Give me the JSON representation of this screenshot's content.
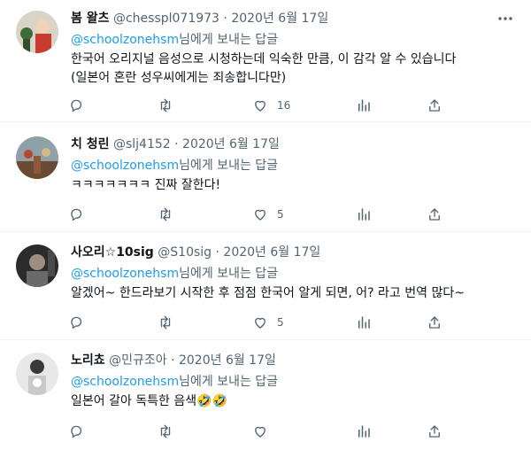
{
  "tweets": [
    {
      "display_name": "봄 왈츠",
      "handle": "@chesspl071973",
      "date": "2020년 6월 17일",
      "mention": "@schoolzonehsm",
      "reply_suffix": "님에게 보내는 답글",
      "text_lines": [
        "한국어 오리지널 음성으로 시청하는데 익숙한 만큼, 이 감각 알 수 있습니다",
        "(일본어 혼란 성우씨에게는 죄송합니다만)"
      ],
      "like_count": "16",
      "avatar_colors": [
        "#d9d4c7",
        "#c93a2f",
        "#3d6b3a"
      ]
    },
    {
      "display_name": "치 청린",
      "handle": "@slj4152",
      "date": "2020년 6월 17일",
      "mention": "@schoolzonehsm",
      "reply_suffix": "님에게 보내는 답글",
      "text_lines": [
        "ㅋㅋㅋㅋㅋㅋㅋ 진짜 잘한다!"
      ],
      "like_count": "5",
      "avatar_colors": [
        "#8fa0a8",
        "#8a5a3a",
        "#b6472e"
      ]
    },
    {
      "display_name": "사오리☆10sig",
      "handle": "@S10sig",
      "date": "2020년 6월 17일",
      "mention": "@schoolzonehsm",
      "reply_suffix": "님에게 보내는 답글",
      "text_lines": [
        "알겠어~ 한드라보기 시작한 후 점점 한국어 알게 되면, 어? 라고 번역 많다~"
      ],
      "like_count": "5",
      "avatar_colors": [
        "#2b2b2b",
        "#6a6a6a",
        "#9c8f80"
      ]
    },
    {
      "display_name": "노리쵸",
      "handle": "@민규조아",
      "date": "2020년 6월 17일",
      "mention": "@schoolzonehsm",
      "reply_suffix": "님에게 보내는 답글",
      "text_lines": [
        "일본어 갈아 독특한 음색🤣🤣"
      ],
      "like_count": "",
      "avatar_colors": [
        "#e8e8e8",
        "#3a3a3a",
        "#c9c9c9"
      ]
    }
  ],
  "separator": " · ",
  "icons": [
    "reply-icon",
    "retweet-icon",
    "like-icon",
    "views-icon",
    "share-icon",
    "more-icon"
  ],
  "colors": {
    "accent": "#1d9bf0",
    "muted": "#536471",
    "text": "#0f1419"
  }
}
